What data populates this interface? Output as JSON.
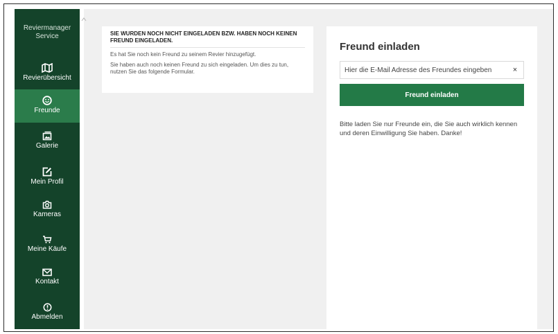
{
  "sidebar": {
    "brand": "Reviermanager Service",
    "items": [
      {
        "label": "Revierübersicht",
        "icon": "map-icon"
      },
      {
        "label": "Freunde",
        "icon": "smiley-icon",
        "active": true
      },
      {
        "label": "Galerie",
        "icon": "gallery-icon"
      },
      {
        "label": "Mein Profil",
        "icon": "edit-icon"
      },
      {
        "label": "Kameras",
        "icon": "camera-icon"
      },
      {
        "label": "Meine Käufe",
        "icon": "cart-icon"
      },
      {
        "label": "Kontakt",
        "icon": "mail-icon"
      },
      {
        "label": "Abmelden",
        "icon": "power-icon"
      }
    ]
  },
  "notice": {
    "title": "Sie wurden noch nicht eingeladen bzw. haben noch keinen Freund eingeladen.",
    "line1": "Es hat Sie noch kein Freund zu seinem Revier hinzugefügt.",
    "line2": "Sie haben auch noch keinen Freund zu sich eingeladen. Um dies zu tun, nutzen Sie das folgende Formular."
  },
  "invite": {
    "heading": "Freund einladen",
    "email_placeholder": "Hier die E-Mail Adresse des Freundes eingeben",
    "email_value": "",
    "clear": "×",
    "button": "Freund einladen",
    "note": "Bitte laden Sie nur Freunde ein, die Sie auch wirklich kennen und deren Einwilligung Sie haben. Danke!"
  },
  "colors": {
    "sidebar_bg": "#14432a",
    "sidebar_active": "#2b7c4b",
    "button_bg": "#237a47",
    "content_bg": "#f0f0f0"
  }
}
